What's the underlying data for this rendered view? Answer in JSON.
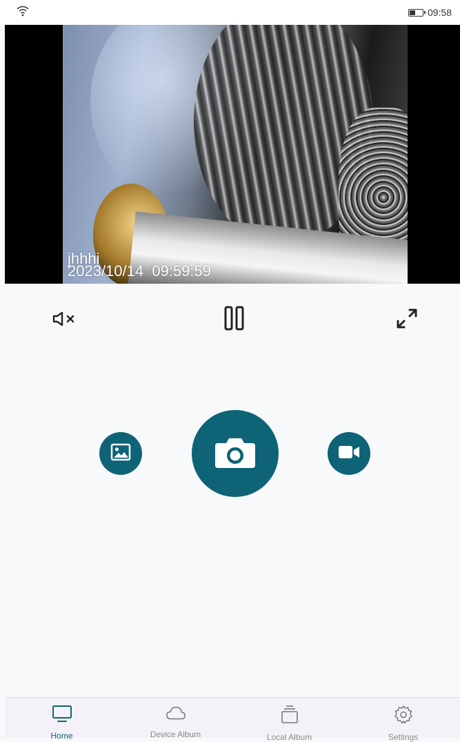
{
  "status_bar": {
    "wifi_icon": "wifi-icon",
    "battery_icon": "battery-icon",
    "battery_level": 0.45,
    "time": "09:58"
  },
  "video": {
    "overlay_name": "jhhhi",
    "overlay_timestamp": "2023/10/14  09:59:59"
  },
  "controls": {
    "mute_icon": "speaker-muted-icon",
    "pause_icon": "pause-icon",
    "fullscreen_icon": "fullscreen-expand-icon"
  },
  "actions": {
    "gallery_icon": "image-icon",
    "capture_icon": "camera-icon",
    "record_icon": "video-camera-icon"
  },
  "tabs": [
    {
      "label": "Home",
      "icon": "monitor-icon",
      "active": true
    },
    {
      "label": "Device Album",
      "icon": "cloud-icon",
      "active": false
    },
    {
      "label": "Local Album",
      "icon": "stack-icon",
      "active": false
    },
    {
      "label": "Settings",
      "icon": "gear-icon",
      "active": false
    }
  ],
  "colors": {
    "accent": "#0e6377",
    "background": "#f8f9fb",
    "tabbar_background": "#f5f1f8"
  }
}
